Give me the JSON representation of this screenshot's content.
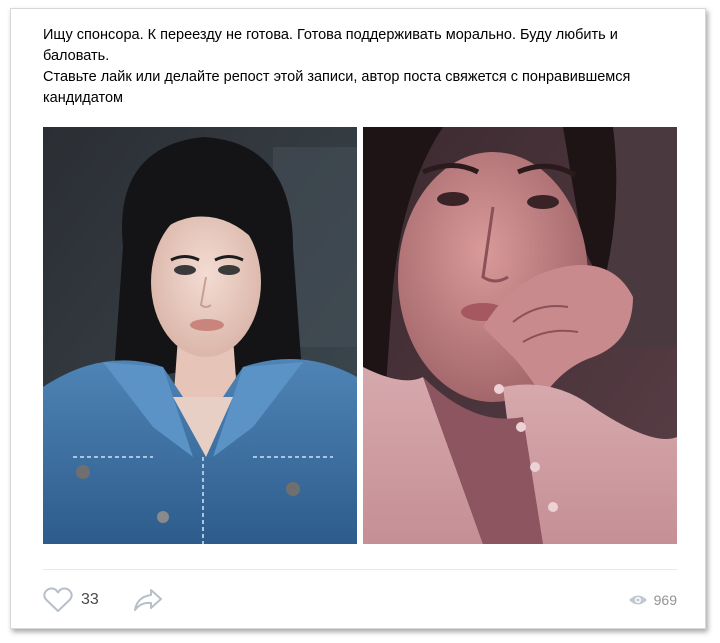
{
  "post": {
    "text_lines": [
      "Ищу спонсора. К переезду не готова. Готова поддерживать морально. Буду любить и баловать.",
      "Ставьте лайк или делайте репост этой записи, автор поста свяжется с понравившемся кандидатом"
    ],
    "photos": [
      {
        "description_icon": "photo-denim-jacket"
      },
      {
        "description_icon": "photo-pink-shirt"
      }
    ]
  },
  "footer": {
    "likes_count": "33",
    "like_icon": "heart-icon",
    "share_icon": "share-arrow-icon",
    "views_icon": "eye-icon",
    "views_count": "969"
  },
  "colors": {
    "icon_gray": "#b8bfc8",
    "text": "#000000",
    "views_text": "#939393"
  }
}
